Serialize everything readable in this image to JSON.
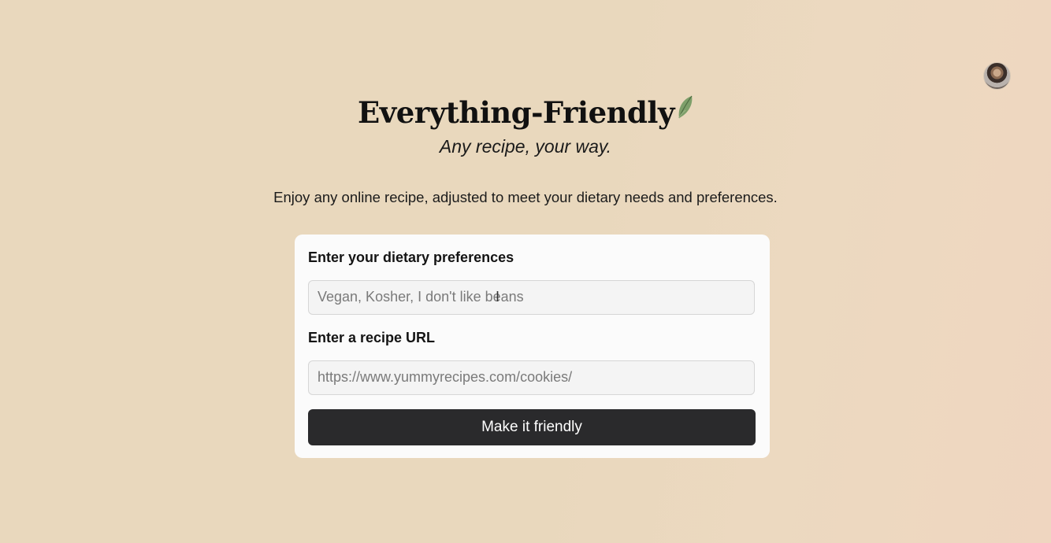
{
  "header": {
    "title": "Everything-Friendly",
    "subtitle": "Any recipe, your way.",
    "tagline": "Enjoy any online recipe, adjusted to meet your dietary needs and preferences.",
    "leaf_icon": "leaf-icon"
  },
  "user": {
    "avatar_icon": "avatar"
  },
  "form": {
    "preferences_label": "Enter your dietary preferences",
    "preferences_placeholder": "Vegan, Kosher, I don't like beans",
    "preferences_value": "",
    "url_label": "Enter a recipe URL",
    "url_placeholder": "https://www.yummyrecipes.com/cookies/",
    "url_value": "",
    "submit_label": "Make it friendly"
  },
  "colors": {
    "background": "#e9d8bd",
    "card": "#fbfbfb",
    "button": "#2a2a2c",
    "leaf": "#6c8f5a"
  }
}
